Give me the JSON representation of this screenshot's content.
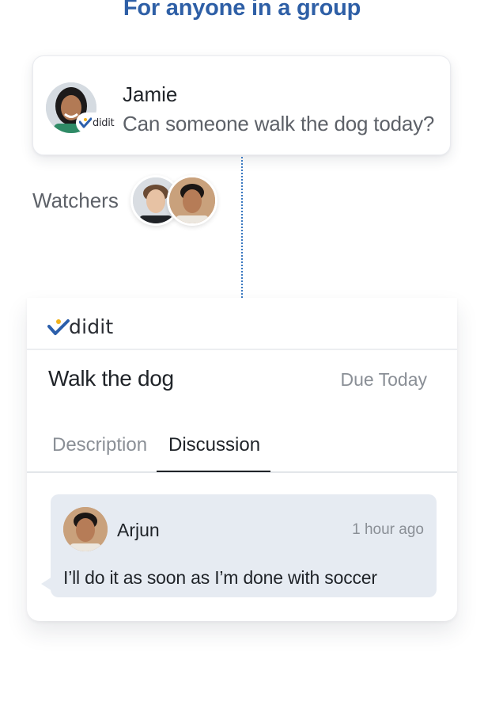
{
  "headline": "For anyone in a group",
  "colors": {
    "accent": "#2e5fa6",
    "logo_check_blue": "#2c5fab",
    "logo_check_yellow": "#f2b21b",
    "comment_bg": "#e6ebf2"
  },
  "message": {
    "sender": "Jamie",
    "text": "Can someone walk the dog today?",
    "badge": "didit"
  },
  "watchers": {
    "label": "Watchers",
    "avatars": [
      "watcher-avatar",
      "watcher-avatar"
    ]
  },
  "task": {
    "logo": "didit",
    "title": "Walk the dog",
    "due": "Due Today",
    "tabs": [
      {
        "label": "Description",
        "active": false
      },
      {
        "label": "Discussion",
        "active": true
      }
    ],
    "comment": {
      "author": "Arjun",
      "time": "1 hour ago",
      "text": "I’ll do it as soon as I’m done with soccer"
    }
  }
}
